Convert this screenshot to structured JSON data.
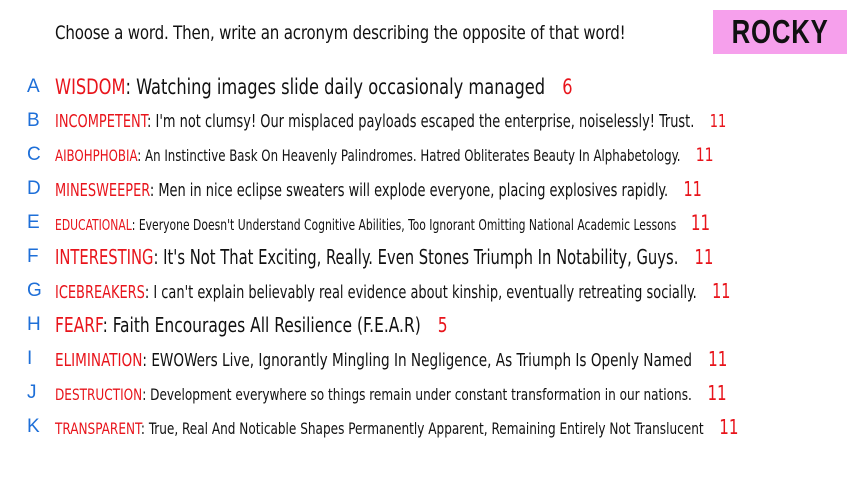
{
  "prompt": "Choose a word. Then, write an acronym describing the opposite of that word!",
  "player_name": "ROCKY",
  "entries": [
    {
      "letter": "A",
      "word": "WISDOM",
      "acronym": "Watching images slide daily occasionaly managed",
      "count": "6"
    },
    {
      "letter": "B",
      "word": "INCOMPETENT",
      "acronym": "I'm not clumsy! Our misplaced payloads escaped the enterprise, noiselessly! Trust.",
      "count": "11"
    },
    {
      "letter": "C",
      "word": "AIBOHPHOBIA",
      "acronym": "An Instinctive Bask On Heavenly Palindromes. Hatred Obliterates Beauty In Alphabetology.",
      "count": "11"
    },
    {
      "letter": "D",
      "word": "MINESWEEPER",
      "acronym": "Men in nice eclipse sweaters will explode everyone, placing explosives rapidly.",
      "count": "11"
    },
    {
      "letter": "E",
      "word": "EDUCATIONAL",
      "acronym": "Everyone Doesn't Understand Cognitive Abilities, Too Ignorant Omitting National Academic Lessons",
      "count": "11"
    },
    {
      "letter": "F",
      "word": "INTERESTING",
      "acronym": "It's Not That Exciting, Really. Even Stones Triumph In Notability, Guys.",
      "count": "11"
    },
    {
      "letter": "G",
      "word": "ICEBREAKERS",
      "acronym": "I can't explain believably real evidence about kinship, eventually retreating socially.",
      "count": "11"
    },
    {
      "letter": "H",
      "word": "FEARF",
      "acronym": "Faith Encourages All Resilience (F.E.A.R)",
      "count": "5"
    },
    {
      "letter": "I",
      "word": "ELIMINATION",
      "acronym": "EWOWers Live, Ignorantly Mingling In Negligence, As Triumph Is Openly Named",
      "count": "11"
    },
    {
      "letter": "J",
      "word": "DESTRUCTION",
      "acronym": "Development everywhere so things remain under constant transformation in our nations.",
      "count": "11"
    },
    {
      "letter": "K",
      "word": "TRANSPARENT",
      "acronym": "True, Real And Noticable Shapes Permanently Apparent, Remaining Entirely Not Translucent",
      "count": "11"
    }
  ]
}
